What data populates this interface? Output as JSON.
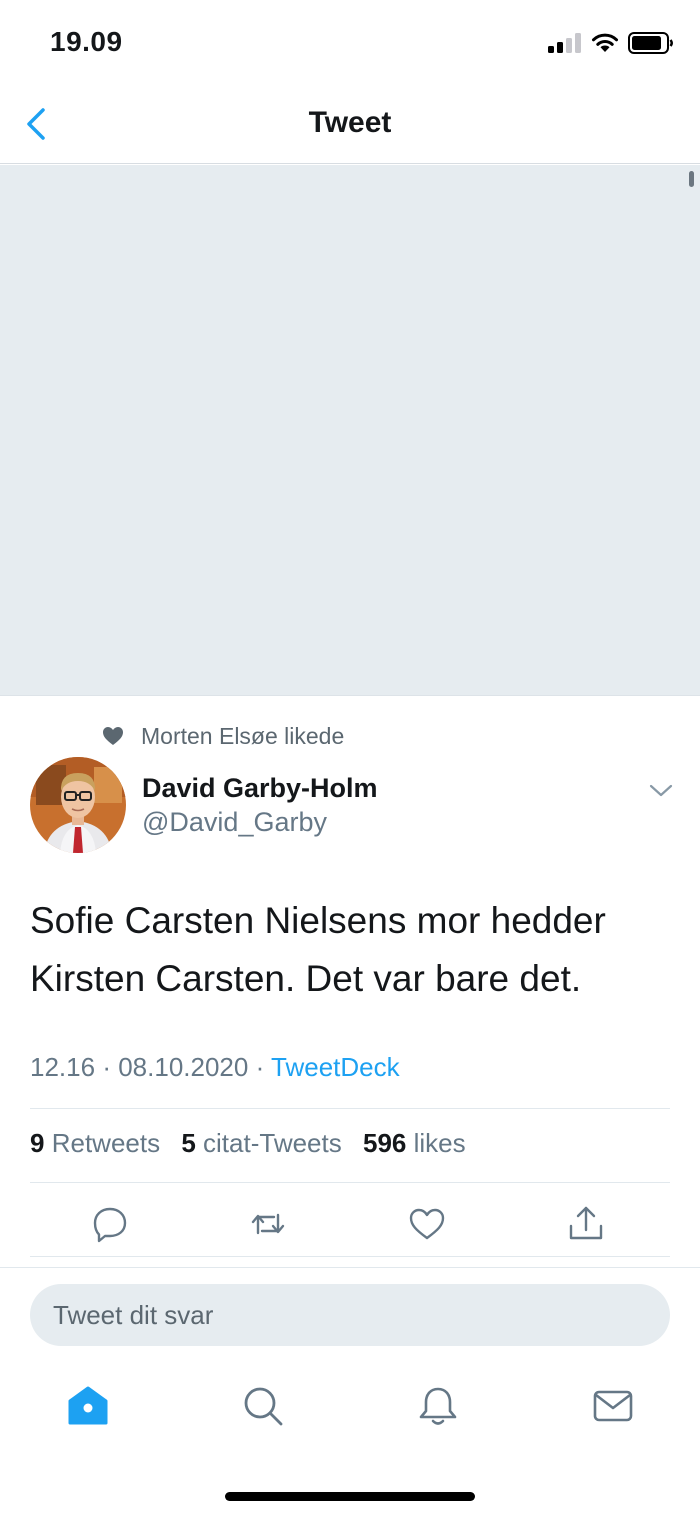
{
  "status_bar": {
    "time": "19.09"
  },
  "nav": {
    "title": "Tweet",
    "back_icon": "chevron-left-icon"
  },
  "tweet": {
    "social_context": "Morten Elsøe likede",
    "author_name": "David Garby-Holm",
    "author_handle": "@David_Garby",
    "text": "Sofie Carsten Nielsens mor hedder Kirsten Carsten. Det var bare det.",
    "time": "12.16",
    "date": "08.10.2020",
    "separator": "·",
    "source": "TweetDeck",
    "stats": {
      "retweets_count": "9",
      "retweets_label": "Retweets",
      "quotes_count": "5",
      "quotes_label": "citat-Tweets",
      "likes_count": "596",
      "likes_label": "likes"
    }
  },
  "actions": [
    "reply-icon",
    "retweet-icon",
    "like-icon",
    "share-icon"
  ],
  "reply": {
    "placeholder": "Tweet dit svar"
  },
  "tabs": [
    "home-icon",
    "search-icon",
    "notifications-icon",
    "messages-icon"
  ],
  "colors": {
    "accent": "#1da1f2",
    "muted": "#657786",
    "media_placeholder": "#e6ecf0"
  }
}
